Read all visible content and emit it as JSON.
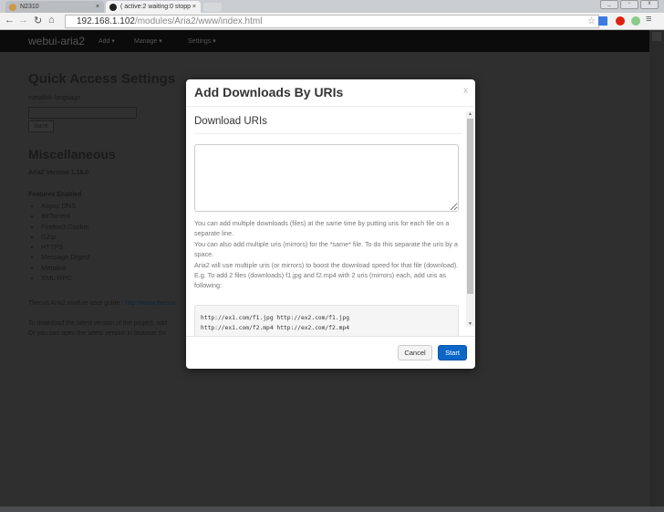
{
  "browser": {
    "tabs": [
      {
        "title": "N2310",
        "close": "×"
      },
      {
        "title": "( active:2 waiting:0 stopp",
        "close": "×"
      }
    ],
    "url_host": "192.168.1.102",
    "url_path": "/modules/Aria2/www/index.html"
  },
  "navbar": {
    "brand": "webui-aria2",
    "menus": [
      "Add ▾",
      "Manage ▾",
      "Settings ▾"
    ]
  },
  "page": {
    "quick_title": "Quick Access Settings",
    "field_label": "metalink-language",
    "save_label": "Save",
    "misc_title": "Miscellaneous",
    "version": "Aria2 Version 1.18.0",
    "features_title": "Features Enabled",
    "features": [
      "Async DNS",
      "BitTorrent",
      "Firefox3 Cookie",
      "GZip",
      "HTTPS",
      "Message Digest",
      "Metalink",
      "XML-RPC"
    ],
    "guide_text": "Thecus Aria2 module user guide : ",
    "guide_link": "http://www.thecus",
    "download_line1": "To download the latest version of the project, add",
    "download_line2": "Or you can open the latest version in browser thr"
  },
  "modal": {
    "title": "Add Downloads By URIs",
    "close": "x",
    "section_title": "Download URIs",
    "textarea_value": "",
    "help": [
      "You can add multiple downloads (files) at the same time by putting uris for each file on a separate line.",
      "You can also add multiple uris (mirrors) for the *same* file. To do this separate the uris by a space.",
      "Aria2 will use multiple uris (or mirrors) to boost the download speed for that file (download).",
      "E.g. To add 2 files (downloads) f1.jpg and f2.mp4 with 2 uris (mirrors) each, add uris as following:"
    ],
    "example": [
      "http://ex1.com/f1.jpg http://ex2.com/f1.jpg",
      "http://ex1.com/f2.mp4 http://ex2.com/f2.mp4"
    ],
    "cancel_label": "Cancel",
    "start_label": "Start"
  },
  "colors": {
    "primary": "#0c66c8",
    "overlay": "#2f2f2f"
  }
}
